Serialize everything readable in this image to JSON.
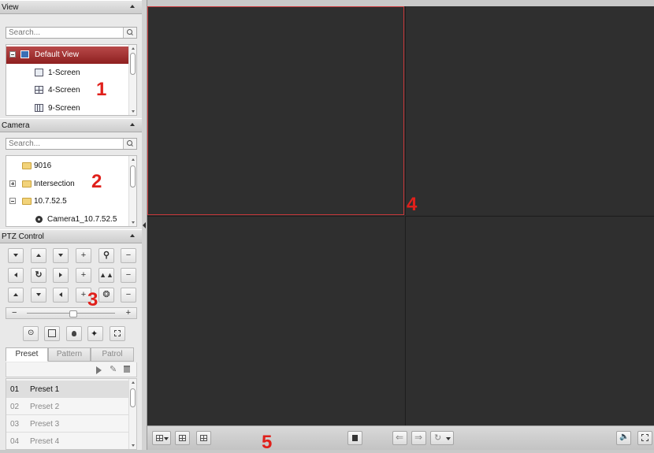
{
  "view_panel": {
    "title": "View",
    "search_placeholder": "Search...",
    "items": [
      {
        "label": "Default View",
        "icon": "view-group-icon",
        "selected": true,
        "expanded": true
      },
      {
        "label": "1-Screen",
        "icon": "1-screen-icon"
      },
      {
        "label": "4-Screen",
        "icon": "4-screen-icon"
      },
      {
        "label": "9-Screen",
        "icon": "9-screen-icon"
      }
    ]
  },
  "camera_panel": {
    "title": "Camera",
    "search_placeholder": "Search...",
    "items": [
      {
        "label": "9016",
        "icon": "folder-icon"
      },
      {
        "label": "Intersection",
        "icon": "folder-icon",
        "expander": "+"
      },
      {
        "label": "10.7.52.5",
        "icon": "folder-icon",
        "expander": "-"
      },
      {
        "label": "Camera1_10.7.52.5",
        "icon": "camera-icon"
      }
    ]
  },
  "ptz_panel": {
    "title": "PTZ Control",
    "slider_minus": "−",
    "slider_plus": "+",
    "tabs": [
      "Preset",
      "Pattern",
      "Patrol"
    ],
    "active_tab": "Preset",
    "presets": [
      {
        "num": "01",
        "name": "Preset 1",
        "selected": true
      },
      {
        "num": "02",
        "name": "Preset 2"
      },
      {
        "num": "03",
        "name": "Preset 3"
      },
      {
        "num": "04",
        "name": "Preset 4"
      }
    ]
  },
  "annotations": [
    "1",
    "2",
    "3",
    "4",
    "5"
  ],
  "colors": {
    "selection_red": "#8e1f1f",
    "annotation_red": "#e0201b",
    "video_bg": "#2f2f2f",
    "selected_window_border": "#c8383b"
  }
}
